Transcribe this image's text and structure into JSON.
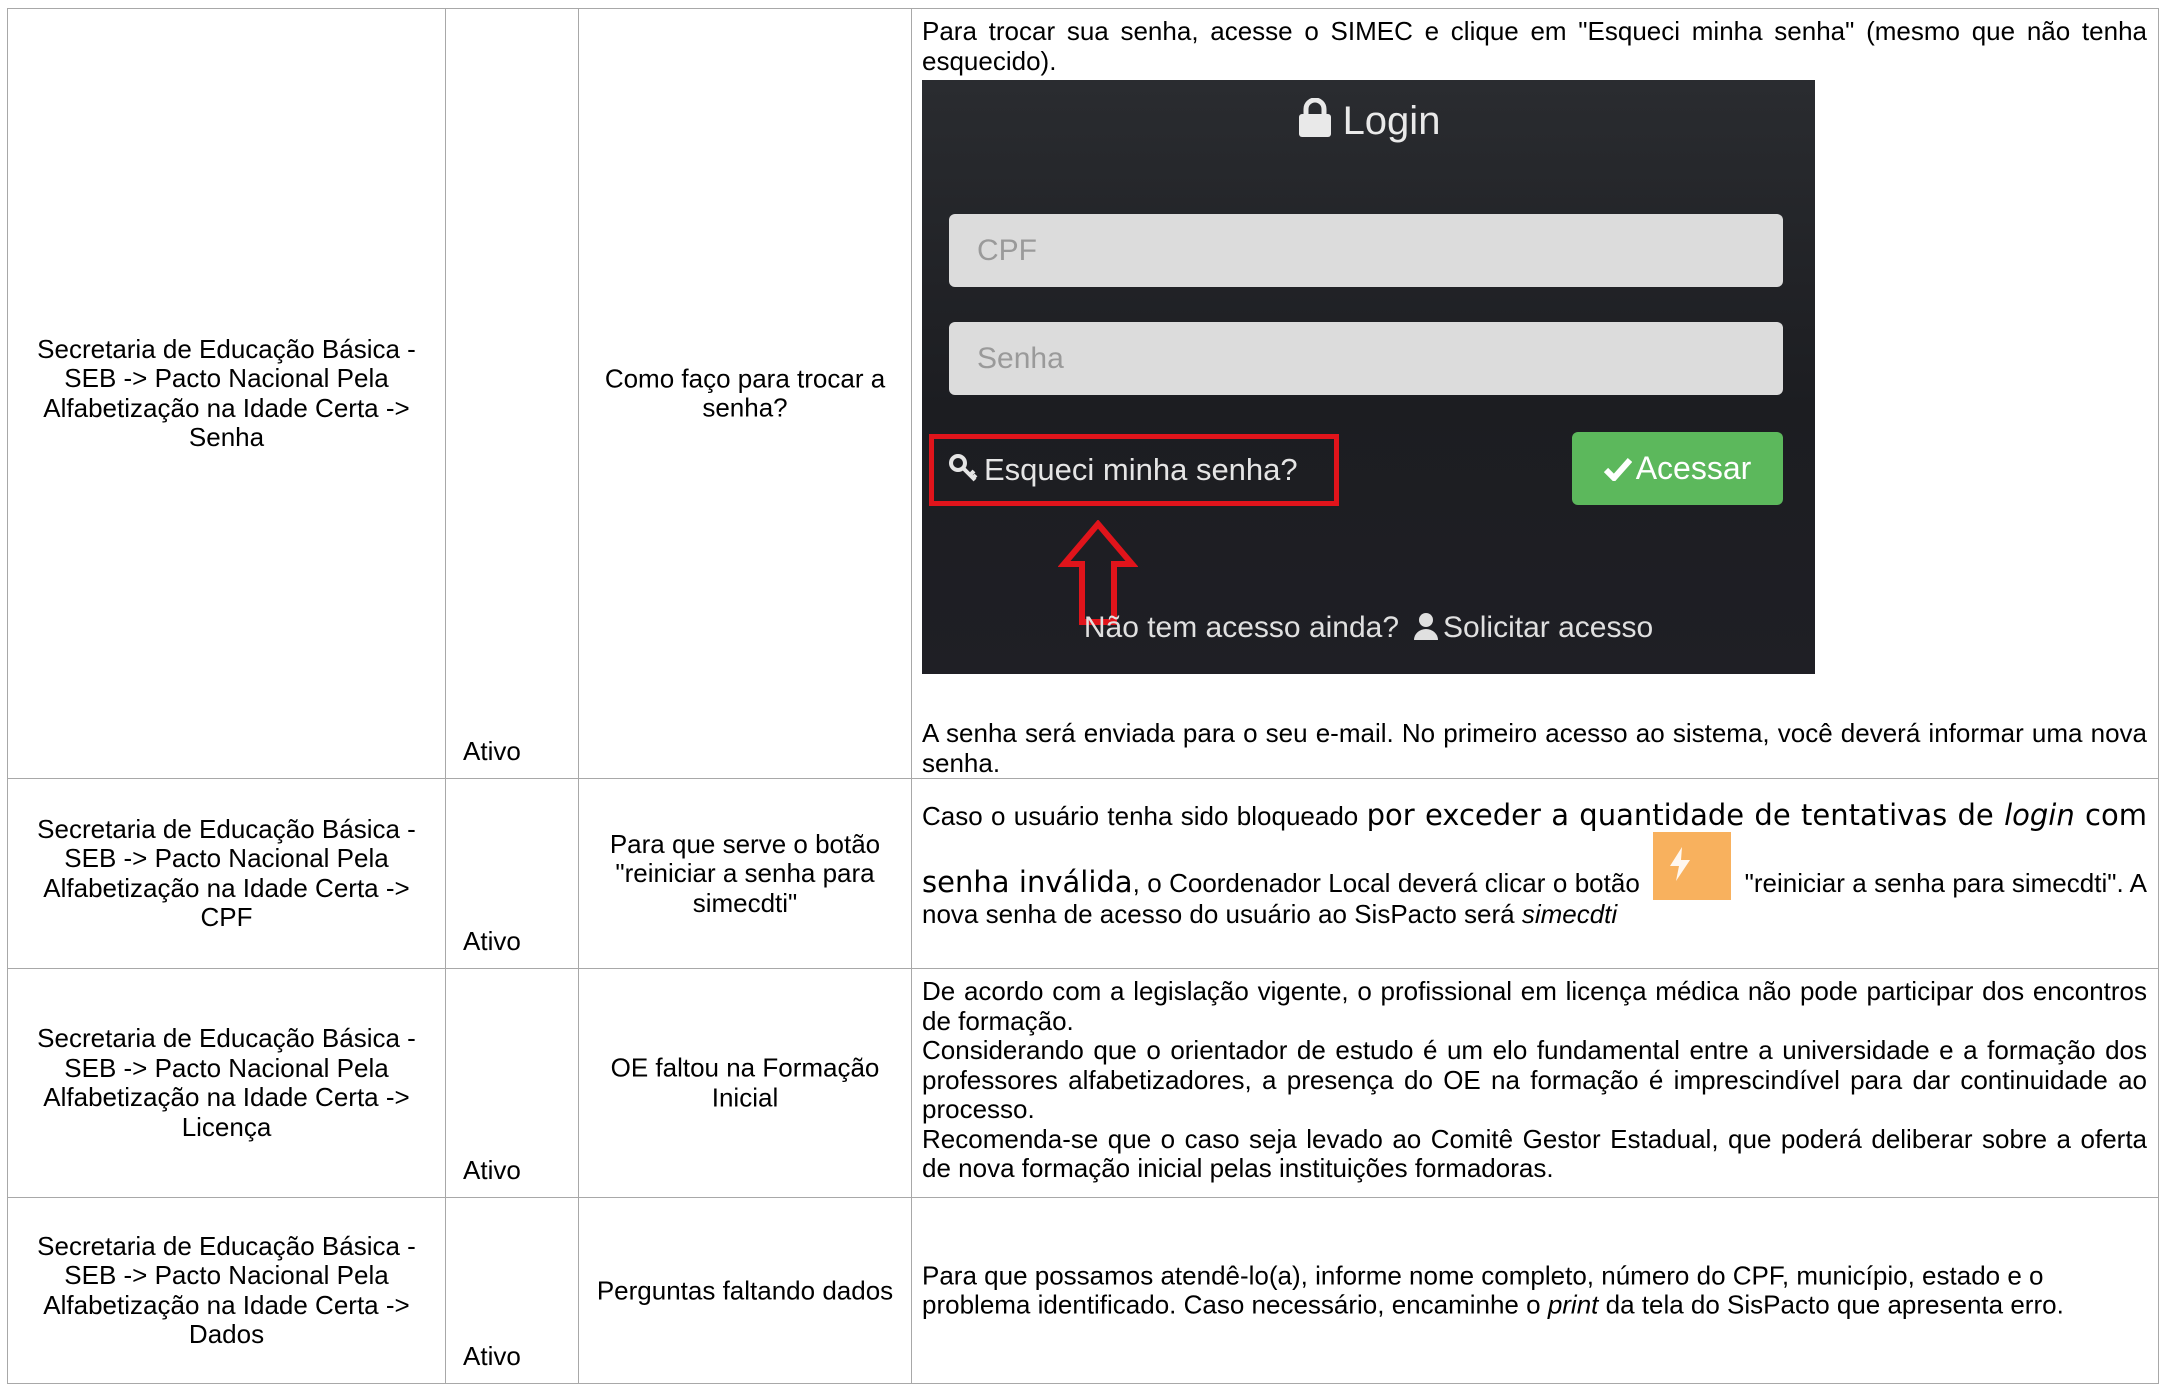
{
  "rows": [
    {
      "path": "Secretaria de Educação Básica - SEB -> Pacto Nacional Pela Alfabetização na Idade Certa -> Senha",
      "status": "Ativo",
      "question": "Como faço para trocar a senha?",
      "answer_intro": "Para trocar sua senha, acesse o SIMEC e clique em \"Esqueci minha senha\" (mesmo que não tenha esquecido).",
      "answer_outro": "A senha será enviada para o seu e-mail. No primeiro acesso ao sistema, você deverá informar uma nova senha."
    },
    {
      "path": "Secretaria de Educação Básica - SEB -> Pacto Nacional Pela Alfabetização na Idade Certa -> CPF",
      "status": "Ativo",
      "question": "Para que serve o botão \"reiniciar a senha para simecdti\"",
      "answer_p1": "Caso o usuário tenha sido bloqueado ",
      "answer_p2": "por exceder a quantidade de tentativas de ",
      "answer_login": "login",
      "answer_p3": " com senha inválida",
      "answer_p4": ", o Coordenador Local deverá clicar o botão ",
      "answer_p5": " \"reiniciar a senha para simecdti\". A nova senha de acesso do usuário ao SisPacto será ",
      "answer_pw": "simecdti"
    },
    {
      "path": "Secretaria de Educação Básica - SEB -> Pacto Nacional Pela Alfabetização na Idade Certa -> Licença",
      "status": "Ativo",
      "question": "OE faltou na Formação Inicial",
      "answer_lines": [
        "De acordo com a legislação vigente, o profissional em licença médica não pode participar dos encontros de formação.",
        "Considerando que o orientador de estudo é um elo fundamental entre a universidade e a formação dos professores alfabetizadores, a presença do OE na formação é imprescindível para dar continuidade ao processo.",
        "Recomenda-se que o caso seja levado ao Comitê Gestor Estadual, que poderá deliberar sobre a oferta de nova formação inicial pelas instituições formadoras."
      ]
    },
    {
      "path": "Secretaria de Educação Básica - SEB -> Pacto Nacional Pela Alfabetização na Idade Certa -> Dados",
      "status": "Ativo",
      "question": "Perguntas faltando dados",
      "answer_p1": "Para que possamos atendê-lo(a), informe nome completo, número do CPF, município, estado e o problema identificado. Caso necessário, encaminhe o ",
      "answer_print": "print",
      "answer_p2": " da tela do SisPacto que apresenta erro."
    }
  ],
  "login_screenshot": {
    "title": "Login",
    "cpf_placeholder": "CPF",
    "senha_placeholder": "Senha",
    "forgot_label": "Esqueci minha senha?",
    "submit_label": "Acessar",
    "no_access_label": "Não tem acesso ainda?",
    "request_label": "Solicitar acesso",
    "colors": {
      "highlight": "#e0141b",
      "submit": "#5cb85c",
      "background": "#1f2024"
    }
  },
  "inline_button": {
    "icon": "bolt-icon",
    "color": "#f8b15e"
  }
}
